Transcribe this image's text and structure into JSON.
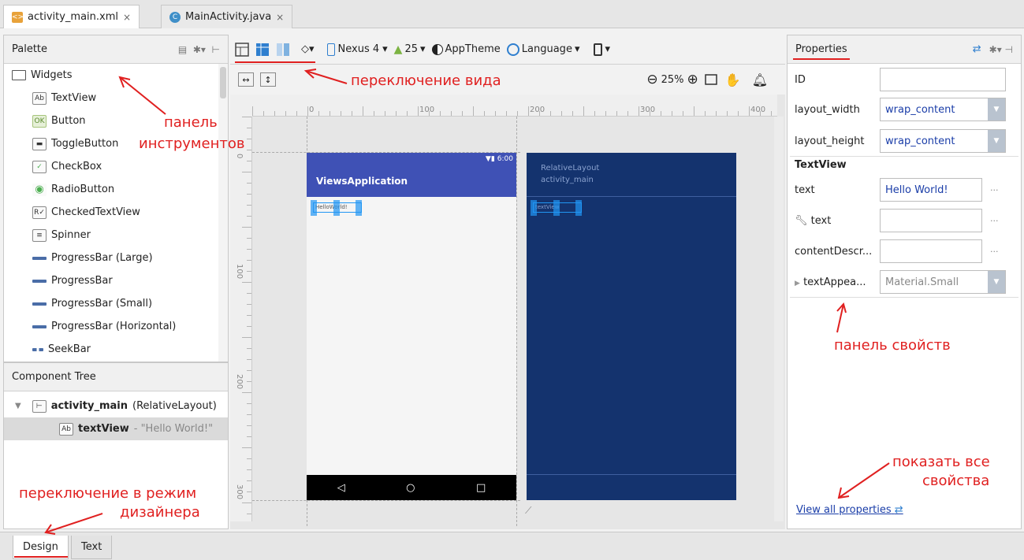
{
  "editor_tabs": [
    {
      "label": "activity_main.xml",
      "close": "×"
    },
    {
      "label": "MainActivity.java",
      "close": "×"
    }
  ],
  "palette": {
    "title": "Palette",
    "category": "Widgets",
    "items": [
      {
        "icon": "Ab",
        "label": "TextView"
      },
      {
        "icon": "OK",
        "label": "Button"
      },
      {
        "icon": "toggle",
        "label": "ToggleButton"
      },
      {
        "icon": "check",
        "label": "CheckBox"
      },
      {
        "icon": "radio",
        "label": "RadioButton"
      },
      {
        "icon": "checked-text",
        "label": "CheckedTextView"
      },
      {
        "icon": "spinner",
        "label": "Spinner"
      },
      {
        "icon": "progress",
        "label": "ProgressBar (Large)"
      },
      {
        "icon": "progress",
        "label": "ProgressBar"
      },
      {
        "icon": "progress",
        "label": "ProgressBar (Small)"
      },
      {
        "icon": "progress",
        "label": "ProgressBar (Horizontal)"
      },
      {
        "icon": "seek",
        "label": "SeekBar"
      }
    ]
  },
  "component_tree": {
    "title": "Component Tree",
    "root_name": "activity_main",
    "root_type": "(RelativeLayout)",
    "child_name": "textView",
    "child_value": "- \"Hello World!\""
  },
  "toolbar": {
    "device": "Nexus 4",
    "api": "25",
    "theme": "AppTheme",
    "language": "Language",
    "zoom": "25%"
  },
  "canvas": {
    "ruler_h": [
      "0",
      "100",
      "200",
      "300",
      "400"
    ],
    "ruler_v": [
      "0",
      "100",
      "200",
      "300"
    ],
    "status_time": "6:00",
    "app_title": "ViewsApplication",
    "hello_text": "HelloWorld!",
    "blueprint_line1": "RelativeLayout",
    "blueprint_line2": "activity_main",
    "blueprint_view": "textView"
  },
  "properties": {
    "title": "Properties",
    "id_label": "ID",
    "id_value": "",
    "layout_width_label": "layout_width",
    "layout_width_value": "wrap_content",
    "layout_height_label": "layout_height",
    "layout_height_value": "wrap_content",
    "section": "TextView",
    "text_label": "text",
    "text_value": "Hello World!",
    "tools_text_label": "text",
    "content_label": "contentDescr...",
    "appearance_label": "textAppea...",
    "appearance_value": "Material.Small",
    "view_all": "View all properties"
  },
  "annotations": {
    "palette": "панель",
    "palette2": "инструментов",
    "view_switch": "переключение вида",
    "props_panel": "панель свойств",
    "show_all": "показать все",
    "show_all2": "свойства",
    "design_mode": "переключение в режим",
    "design_mode2": "дизайнера"
  },
  "bottom_tabs": [
    "Design",
    "Text"
  ],
  "colors": {
    "accent": "#3f51b5",
    "blueprint": "#14336e",
    "annotation": "#e02020"
  }
}
